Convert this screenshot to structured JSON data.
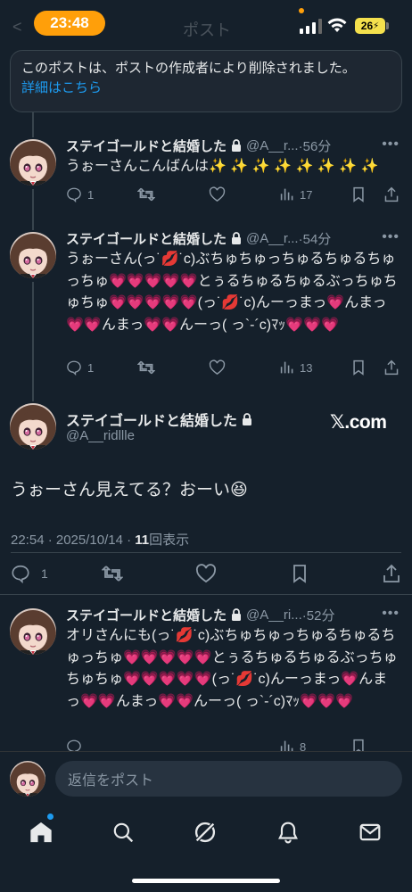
{
  "status_bar": {
    "time": "23:48",
    "battery": "26"
  },
  "header_ghost": {
    "back": "<",
    "title": "ポスト"
  },
  "deleted_notice": {
    "text": "このポストは、ポストの作成者により削除されました。",
    "link": "詳細はこちら"
  },
  "tweets": [
    {
      "name": "ステイゴールドと結婚した",
      "handle": "@A__r...",
      "time": "·56分",
      "text": "うぉーさんこんばんは✨ ✨ ✨ ✨ ✨ ✨ ✨ ✨",
      "replies": "1",
      "retweets": "",
      "likes": "",
      "views": "17"
    },
    {
      "name": "ステイゴールドと結婚した",
      "handle": "@A__r...",
      "time": "·54分",
      "text": "うぉーさん(っ˙💋˙c)ぶちゅちゅっちゅるちゅるちゅっちゅ💗💗💗💗💗とぅるちゅるちゅるぶっちゅちゅちゅ💗💗💗💗💗(っ˙💋˙c)んーっまっ💗んまっ💗💗んまっ💗💗んーっ( っ`-´c)ﾏｯ💗💗💗",
      "replies": "1",
      "retweets": "",
      "likes": "",
      "views": "13"
    }
  ],
  "focused": {
    "name": "ステイゴールドと結婚した",
    "handle": "@A__ridllle",
    "badge": "𝕏.com",
    "text": "うぉーさん見えてる？おーい😆",
    "meta_prefix": "22:54 · 2025/10/14 · ",
    "views_count": "11",
    "views_label": "回表示",
    "replies": "1"
  },
  "reply_tweet": {
    "name": "ステイゴールドと結婚した",
    "handle": "@A__ri...",
    "time": "·52分",
    "text": "オリさんにも(っ˙💋˙c)ぶちゅちゅっちゅるちゅるちゅっちゅ💗💗💗💗💗とぅるちゅるちゅるぶっちゅちゅちゅ💗💗💗💗💗(っ˙💋˙c)んーっまっ💗んまっ💗💗んまっ💗💗んーっ( っ`-´c)ﾏｯ💗💗💗",
    "views": "8"
  },
  "reply_bar": {
    "placeholder": "返信をポスト"
  },
  "tab_bar": {
    "items": [
      "home-icon",
      "search-icon",
      "grok-icon",
      "notifications-icon",
      "messages-icon"
    ]
  },
  "colors": {
    "background": "#15202b",
    "accent": "#1d9bf0",
    "muted": "#8b98a5",
    "border": "#38444d"
  }
}
